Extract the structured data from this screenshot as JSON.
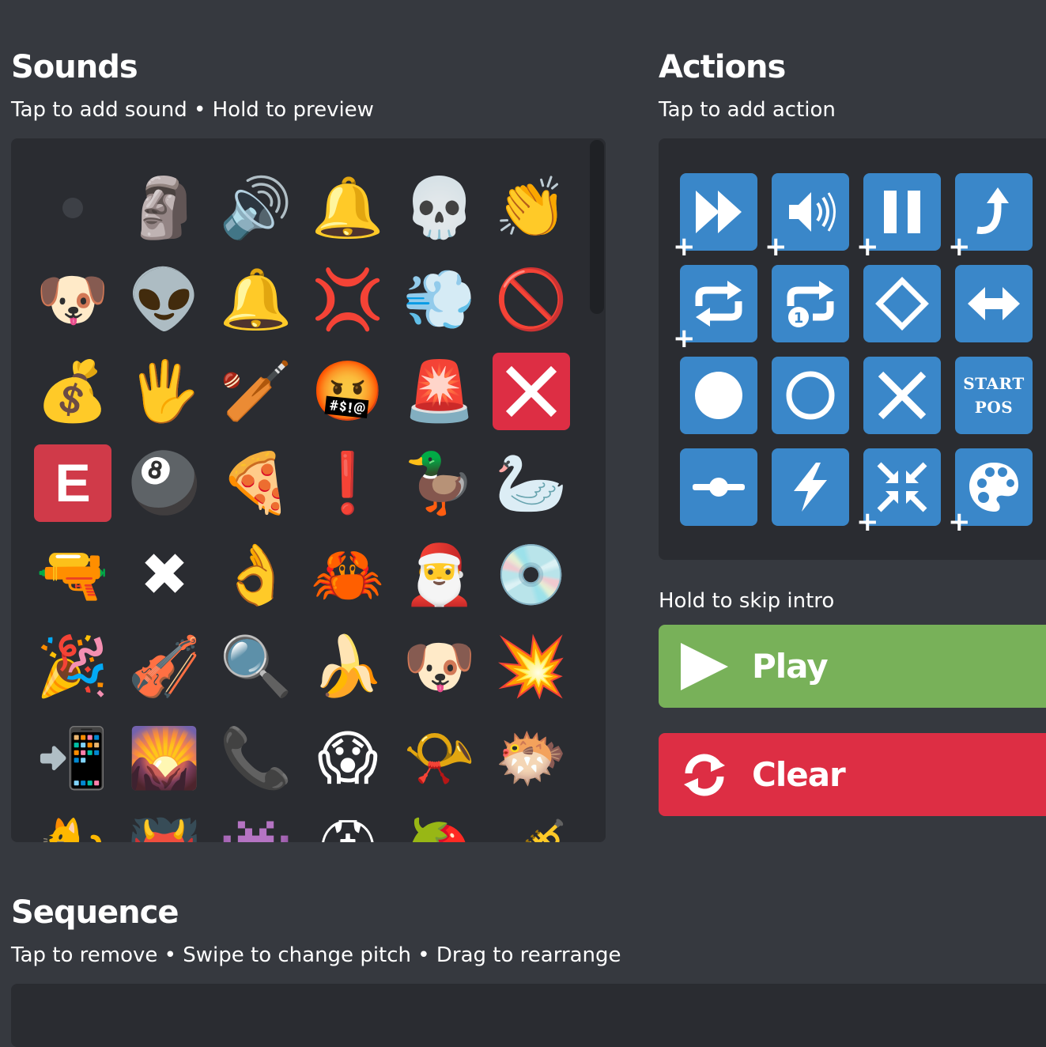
{
  "sounds": {
    "title": "Sounds",
    "hint": "Tap to add sound • Hold to preview",
    "items": [
      "",
      "🗿",
      "🔊",
      "🔔",
      "💀",
      "👏",
      "🐶",
      "👽",
      "🔔",
      "💢",
      "💨",
      "🚫",
      "💰",
      "🖐",
      "🏏",
      "🤬",
      "🚨",
      "❌",
      "E",
      "🎱",
      "🍕",
      "❗",
      "🦆",
      "🦢",
      "🔫",
      "✖",
      "👌",
      "🦀",
      "🎅",
      "💿",
      "🎉",
      "🎻",
      "🔍",
      "🍌",
      "🐶",
      "💥",
      "📲",
      "🌄",
      "📞",
      "😱",
      "📯",
      "🐡",
      "🐈",
      "👹",
      "👾",
      "⛑",
      "🍓",
      "🎺"
    ]
  },
  "actions": {
    "title": "Actions",
    "hint": "Tap to add action",
    "start_pos_line1": "START",
    "start_pos_line2": "POS",
    "items": [
      {
        "name": "fast-forward-icon",
        "plus": true
      },
      {
        "name": "speaker-icon",
        "plus": true
      },
      {
        "name": "pause-icon",
        "plus": true
      },
      {
        "name": "jump-arrow-icon",
        "plus": true
      },
      {
        "name": "repeat-icon",
        "plus": true
      },
      {
        "name": "repeat-once-icon",
        "plus": false
      },
      {
        "name": "diamond-icon",
        "plus": false
      },
      {
        "name": "left-right-arrow-icon",
        "plus": false
      },
      {
        "name": "filled-circle-icon",
        "plus": false
      },
      {
        "name": "hollow-circle-icon",
        "plus": false
      },
      {
        "name": "x-icon",
        "plus": false
      },
      {
        "name": "start-pos-icon",
        "plus": false
      },
      {
        "name": "slider-icon",
        "plus": false
      },
      {
        "name": "lightning-icon",
        "plus": false
      },
      {
        "name": "compress-icon",
        "plus": true
      },
      {
        "name": "palette-icon",
        "plus": true
      }
    ]
  },
  "controls": {
    "skip_hint": "Hold to skip intro",
    "play_label": "Play",
    "clear_label": "Clear"
  },
  "sequence": {
    "title": "Sequence",
    "hint": "Tap to remove • Swipe to change pitch • Drag to rearrange"
  },
  "colors": {
    "background": "#36393f",
    "panel": "#2a2c31",
    "action_blue": "#3a87c9",
    "play_green": "#78b159",
    "clear_red": "#dd2e44"
  }
}
